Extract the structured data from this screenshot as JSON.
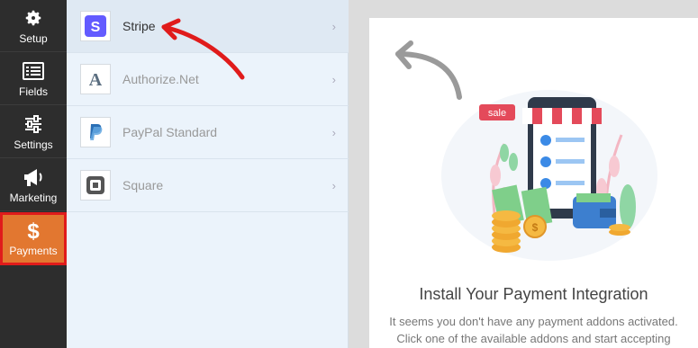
{
  "sidebar": {
    "items": [
      {
        "label": "Setup",
        "icon": "gear-icon"
      },
      {
        "label": "Fields",
        "icon": "list-icon"
      },
      {
        "label": "Settings",
        "icon": "sliders-icon"
      },
      {
        "label": "Marketing",
        "icon": "megaphone-icon"
      },
      {
        "label": "Payments",
        "icon": "dollar-icon",
        "active": true
      }
    ]
  },
  "addons": [
    {
      "name": "Stripe",
      "selected": true
    },
    {
      "name": "Authorize.Net",
      "selected": false
    },
    {
      "name": "PayPal Standard",
      "selected": false
    },
    {
      "name": "Square",
      "selected": false
    }
  ],
  "main": {
    "title": "Install Your Payment Integration",
    "description": "It seems you don't have any payment addons activated. Click one of the available addons and start accepting",
    "sale_tag": "sale"
  },
  "colors": {
    "sidebar_bg": "#2d2d2d",
    "active_bg": "#e27730",
    "highlight_outline": "#e01b1b",
    "stripe_brand": "#635bff",
    "panel_bg": "#ebf3fb"
  }
}
